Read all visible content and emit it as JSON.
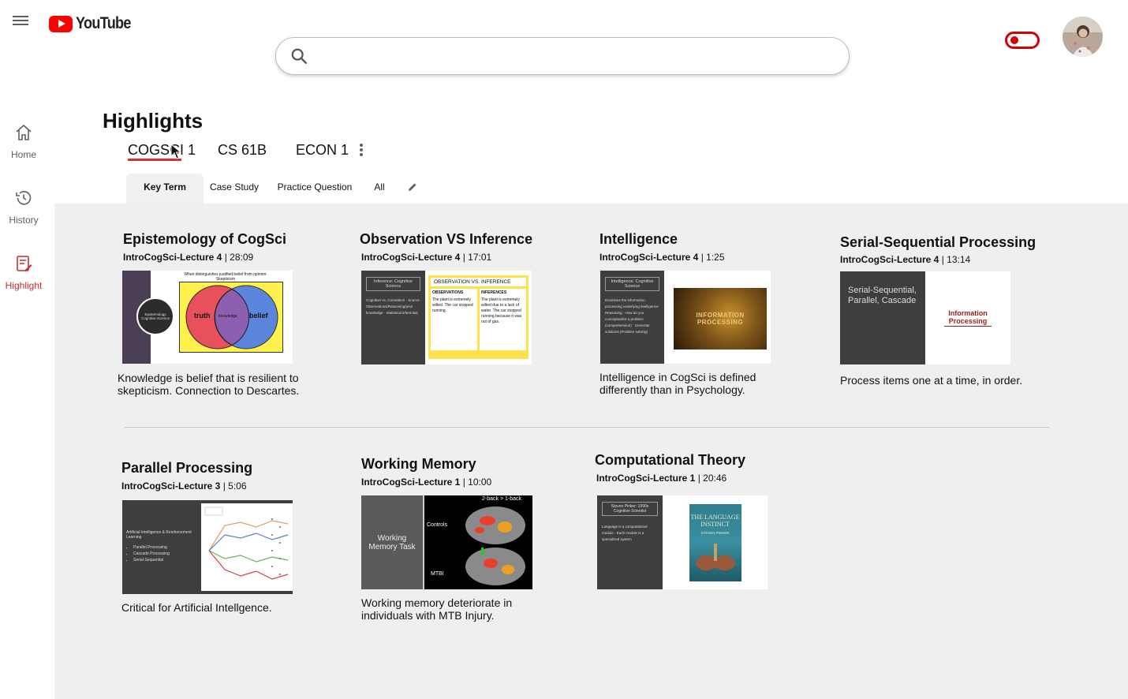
{
  "header": {
    "logo_text": "YouTube",
    "search_placeholder": "",
    "brand_color": "#ff0000"
  },
  "sidebar": {
    "items": [
      {
        "label": "Home",
        "icon": "home-icon"
      },
      {
        "label": "History",
        "icon": "history-icon"
      },
      {
        "label": "Highlight",
        "icon": "highlight-icon",
        "active": true
      }
    ]
  },
  "page": {
    "title": "Highlights",
    "course_tabs": [
      "COGSCI 1",
      "CS 61B",
      "ECON 1"
    ],
    "sub_tabs": [
      "Key Term",
      "Case Study",
      "Practice Question",
      "All"
    ]
  },
  "cards": [
    {
      "title": "Epistemology of CogSci",
      "lecture": "IntroCogSci-Lecture 4",
      "time": "28:09",
      "description": "Knowledge is belief that is resilient to skepticism. Connection to Descartes.",
      "slide_heading": "When distinguishes justified belief from opinion: Skepticism",
      "slide_left": "Epistemology Cognitive Science",
      "venn_left": "truth",
      "venn_mid": "knowledge",
      "venn_right": "belief"
    },
    {
      "title": "Observation VS Inference",
      "lecture": "IntroCogSci-Lecture 4",
      "time": "17:01",
      "description": "",
      "slide_left": "Inference: Cognitive Science",
      "slide_left_body": "Cognition vs. Correlation · Source: Observations/Reasoning/prior knowledge · Statistical inferential",
      "slide_banner": "OBSERVATION VS. INFERENCE",
      "col1": "OBSERVATIONS",
      "col2": "INFERENCES",
      "col1_body": "The plant is extremely wilted. The car stopped running.",
      "col2_body": "The plant is extremely wilted due to a lack of water. The car stopped running because it was out of gas."
    },
    {
      "title": "Intelligence",
      "lecture": "IntroCogSci-Lecture 4",
      "time": "1:25",
      "description": "Intelligence in CogSci is defined differently than in Psychology.",
      "slide_left": "Intelligence: Cognitive Science",
      "slide_left_body": "Examines the information processing underlying intelligence: Reasoning · How do you conceptualize a problem (comprehension) · Generate solutions (Problem solving)",
      "image_text": "INFORMATION PROCESSING"
    },
    {
      "title": "Serial-Sequential Processing",
      "lecture": "IntroCogSci-Lecture 4",
      "time": "13:14",
      "description": "Process items one at a time, in order.",
      "slide_left": "Serial-Sequential, Parallel, Cascade",
      "slide_right": "Information Processing"
    },
    {
      "title": "Parallel Processing",
      "lecture": "IntroCogSci-Lecture 3",
      "time": "5:06",
      "description": "Critical for Artificial Intellgence.",
      "slide_left": "Artificial Intelligence & Reinforcement Learning",
      "bullets": [
        "Parallel Processing",
        "Cascade Processing",
        "Serial-Sequential"
      ]
    },
    {
      "title": "Working Memory",
      "lecture": "IntroCogSci-Lecture 1",
      "time": "10:00",
      "description": "Working memory deteriorate in individuals with MTB Injury.",
      "slide_left": "Working Memory Task",
      "scan_top": "2-back > 1-back",
      "scan_label1": "Controls",
      "scan_label2": "MTBI"
    },
    {
      "title": "Computational Theory",
      "lecture": "IntroCogSci-Lecture 1",
      "time": "20:46",
      "description": "",
      "slide_left": "Steven Pinker: 1990s Cognitive Scientist",
      "slide_left_body": "Language is a computational module · Each module is a specialized system",
      "book_title": "THE LANGUAGE INSTINCT",
      "book_author": "STEVEN PINKER"
    }
  ],
  "colors": {
    "accent": "#c4302b",
    "panel": "#efefef",
    "slide_dark": "#3e3e3e"
  }
}
